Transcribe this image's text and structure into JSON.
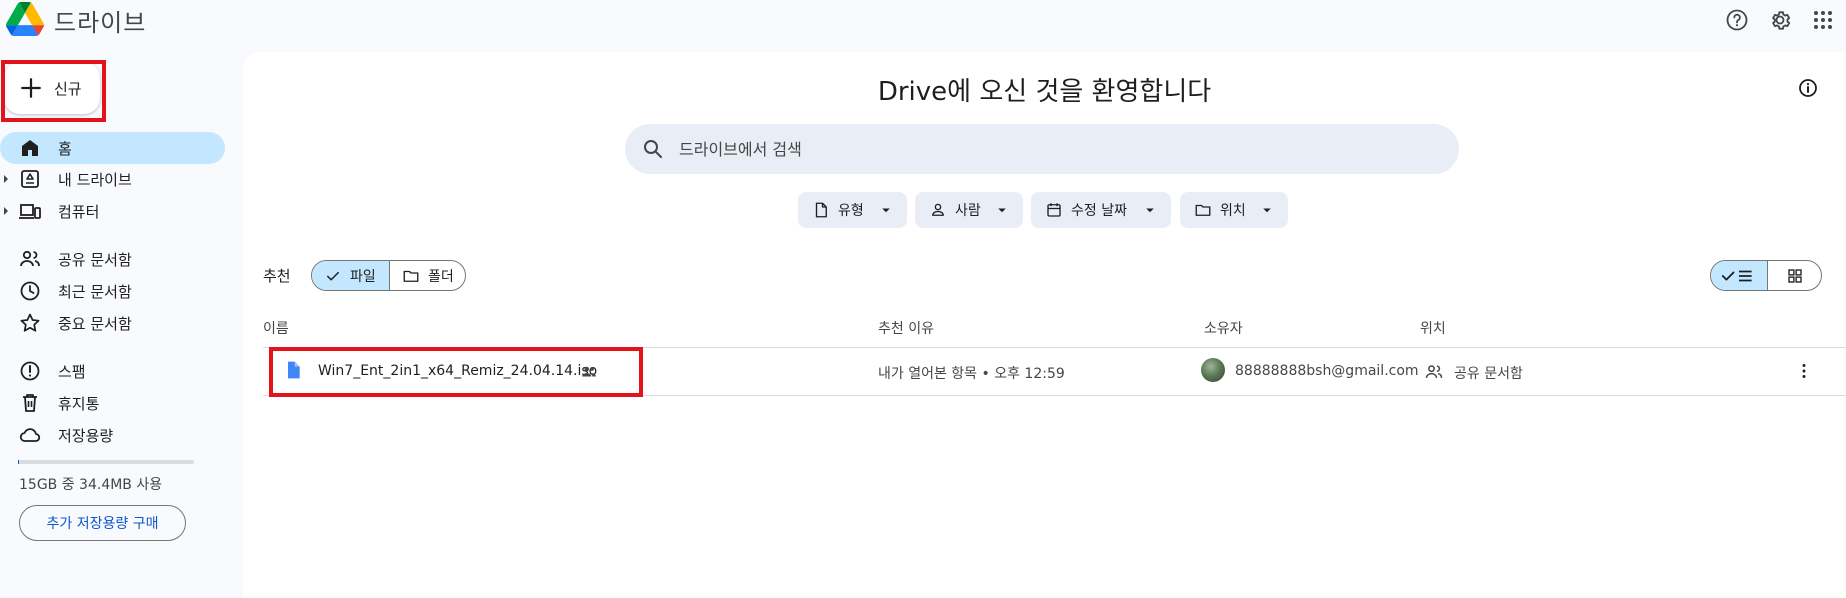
{
  "app": {
    "title": "드라이브"
  },
  "new_button": {
    "label": "신규"
  },
  "sidebar": {
    "items": [
      {
        "label": "홈",
        "icon": "home-icon",
        "active": true
      },
      {
        "label": "내 드라이브",
        "icon": "my-drive-icon",
        "expandable": true
      },
      {
        "label": "컴퓨터",
        "icon": "computers-icon",
        "expandable": true
      },
      {
        "label": "공유 문서함",
        "icon": "people-icon"
      },
      {
        "label": "최근 문서함",
        "icon": "clock-icon"
      },
      {
        "label": "중요 문서함",
        "icon": "star-icon"
      },
      {
        "label": "스팸",
        "icon": "spam-icon"
      },
      {
        "label": "휴지통",
        "icon": "trash-icon"
      },
      {
        "label": "저장용량",
        "icon": "cloud-icon"
      }
    ],
    "storage": {
      "text": "15GB 중 34.4MB 사용",
      "used_fraction": 0.0022
    },
    "buy_storage_label": "추가 저장용량 구매"
  },
  "main": {
    "welcome": "Drive에 오신 것을 환영합니다",
    "search_placeholder": "드라이브에서 검색",
    "filters": [
      {
        "label": "유형",
        "icon": "file-icon"
      },
      {
        "label": "사람",
        "icon": "person-icon"
      },
      {
        "label": "수정 날짜",
        "icon": "calendar-icon"
      },
      {
        "label": "위치",
        "icon": "folder-icon"
      }
    ],
    "suggested_label": "추천",
    "segments": {
      "files": "파일",
      "folders": "폴더",
      "selected": "files"
    },
    "columns": {
      "name": "이름",
      "reason": "추천 이유",
      "owner": "소유자",
      "location": "위치"
    },
    "files": [
      {
        "name": "Win7_Ent_2in1_x64_Remiz_24.04.14.iso",
        "shared": true,
        "reason": "내가 열어본 항목 • 오후 12:59",
        "owner": "88888888bsh@gmail.com",
        "location": "공유 문서함"
      }
    ]
  },
  "colors": {
    "accent": "#0b57d0",
    "active_bg": "#c2e7ff",
    "highlight_box": "#e2131b"
  }
}
